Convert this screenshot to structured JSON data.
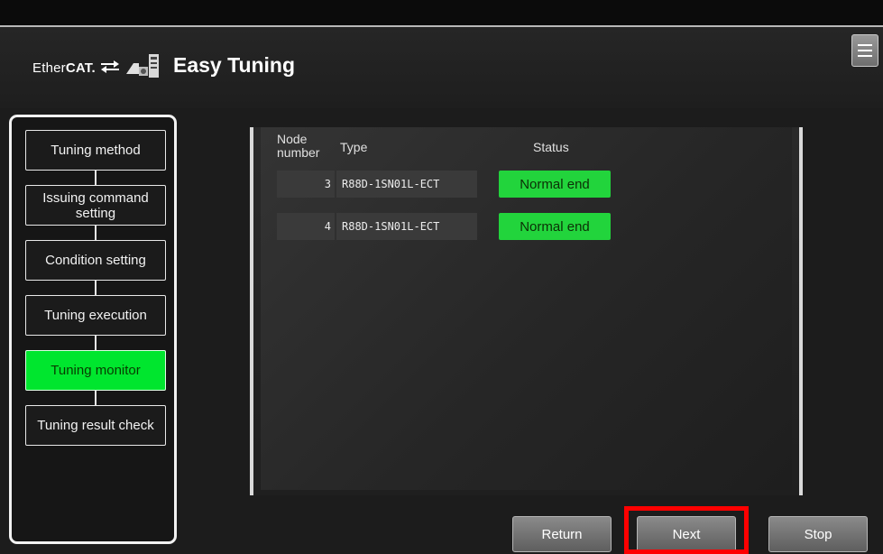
{
  "header": {
    "logo_prefix": "Ether",
    "logo_bold": "CAT",
    "logo_suffix": ".",
    "title": "Easy Tuning"
  },
  "sidebar": {
    "steps": [
      {
        "label": "Tuning method",
        "active": false
      },
      {
        "label": "Issuing command setting",
        "active": false
      },
      {
        "label": "Condition setting",
        "active": false
      },
      {
        "label": "Tuning execution",
        "active": false
      },
      {
        "label": "Tuning monitor",
        "active": true
      },
      {
        "label": "Tuning result check",
        "active": false
      }
    ]
  },
  "table": {
    "headers": {
      "node": "Node number",
      "type": "Type",
      "status": "Status"
    },
    "rows": [
      {
        "node": "3",
        "type": "R88D-1SN01L-ECT",
        "status": "Normal end"
      },
      {
        "node": "4",
        "type": "R88D-1SN01L-ECT",
        "status": "Normal end"
      }
    ]
  },
  "buttons": {
    "return": "Return",
    "next": "Next",
    "stop": "Stop"
  },
  "colors": {
    "active_step": "#00e62e",
    "status_ok": "#22d43c",
    "highlight": "#ff0000"
  },
  "icons": [
    "ethercat-arrows-icon",
    "servo-drive-icon",
    "menu-icon"
  ]
}
